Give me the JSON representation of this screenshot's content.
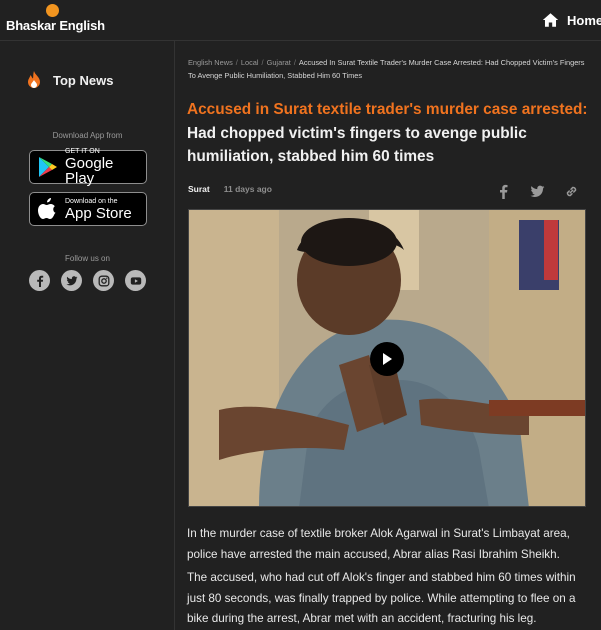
{
  "header": {
    "logo_text": "Bhaskar English",
    "home_label": "Home",
    "home_icon": "home-icon"
  },
  "sidebar": {
    "top_news_label": "Top News",
    "top_news_icon": "fire-icon",
    "download_label": "Download App from",
    "google_play": {
      "small": "GET IT ON",
      "big": "Google Play"
    },
    "app_store": {
      "small": "Download on the",
      "big": "App Store"
    },
    "follow_label": "Follow us on",
    "socials": [
      "facebook-icon",
      "twitter-icon",
      "instagram-icon",
      "youtube-icon"
    ]
  },
  "article": {
    "breadcrumb": [
      "English News",
      "Local",
      "Gujarat",
      "Accused In Surat Textile Trader's Murder Case Arrested: Had Chopped Victim's Fingers To Avenge Public Humiliation, Stabbed Him 60 Times"
    ],
    "headline_accent": "Accused in Surat textile trader's murder case arrested:",
    "headline_rest": " Had chopped victim's fingers to avenge public humiliation, stabbed him 60 times",
    "city": "Surat",
    "time": "11 days ago",
    "share_icons": [
      "facebook-icon",
      "twitter-icon",
      "link-icon"
    ],
    "video_play_icon": "play-icon",
    "paragraphs": [
      "In the murder case of textile broker Alok Agarwal in Surat's Limbayat area, police have arrested the main accused, Abrar alias Rasi Ibrahim Sheikh.",
      "The accused, who had cut off Alok's finger and stabbed him 60 times within just 80 seconds, was finally trapped by police. While attempting to flee on a bike during the arrest, Abrar met with an accident, fracturing his leg."
    ]
  },
  "colors": {
    "background": "#212121",
    "accent": "#f0731f",
    "logo_dot": "#f29520"
  }
}
